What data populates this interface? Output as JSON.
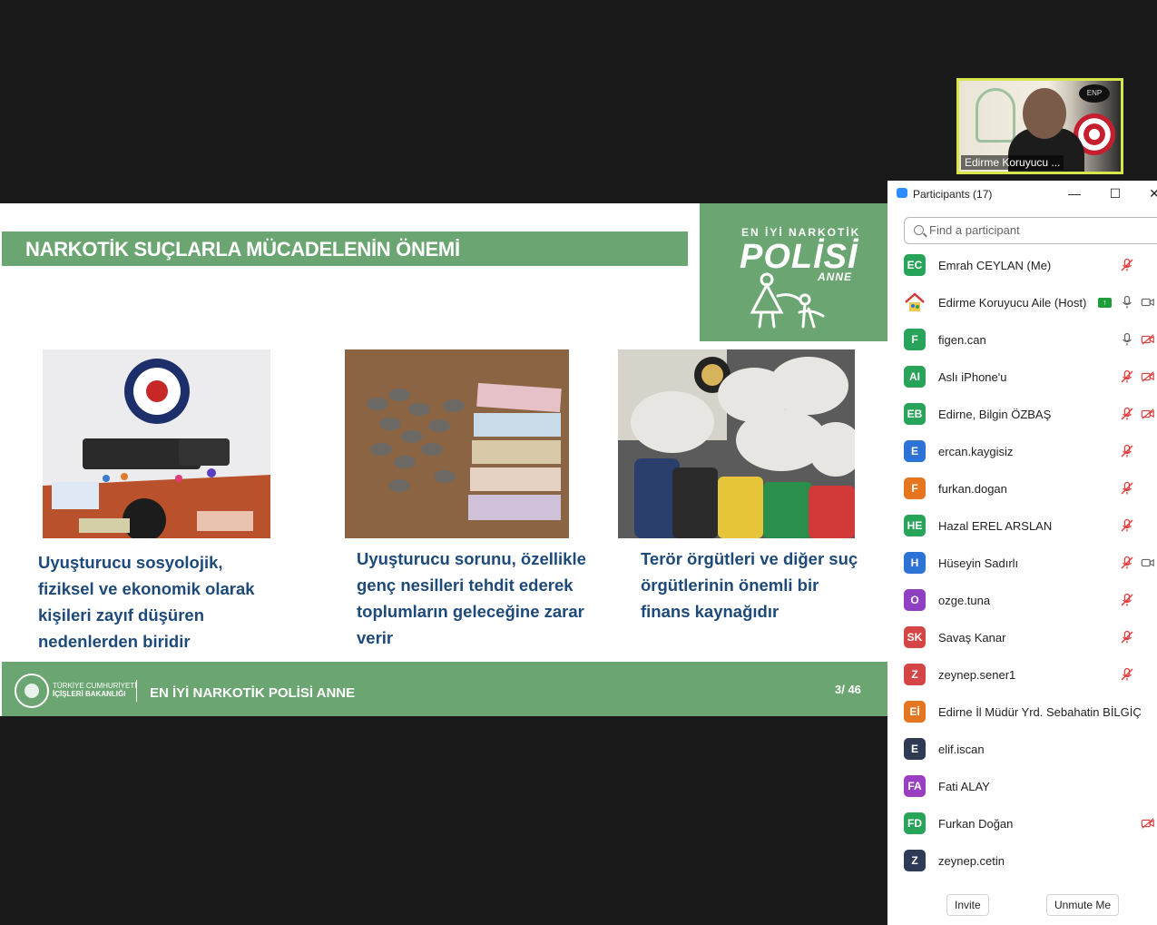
{
  "video": {
    "participant_label": "Edirme Koruyucu ..."
  },
  "slide": {
    "title": "NARKOTİK SUÇLARLA MÜCADELENİN ÖNEMİ",
    "brand": {
      "top": "EN İYİ NARKOTİK",
      "main": "POLİSİ",
      "sub": "ANNE"
    },
    "captions": [
      "Uyuşturucu sosyolojik, fiziksel ve ekonomik olarak kişileri zayıf düşüren nedenlerden biridir",
      "Uyuşturucu sorunu, özellikle genç nesilleri tehdit ederek toplumların geleceğine zarar verir",
      "Terör örgütleri ve diğer suç örgütlerinin önemli bir finans kaynağıdır"
    ],
    "footer": {
      "ministry_line1": "TÜRKİYE CUMHURİYETİ",
      "ministry_line2": "İÇİŞLERİ BAKANLIĞI",
      "title": "EN İYİ NARKOTİK POLİSİ ANNE",
      "page": "3/ 46"
    }
  },
  "panel": {
    "title": "Participants (17)",
    "search_placeholder": "Find a participant",
    "participants": [
      {
        "initials": "EC",
        "name": "Emrah CEYLAN (Me)",
        "color": "#27a35a",
        "mic": "muted-red",
        "video": "none"
      },
      {
        "initials": "",
        "name": "Edirme Koruyucu Aile (Host)",
        "color": "#ffffff",
        "mic": "on",
        "video": "on",
        "sharing": true
      },
      {
        "initials": "F",
        "name": "figen.can",
        "color": "#27a35a",
        "mic": "on",
        "video": "off"
      },
      {
        "initials": "AI",
        "name": "Aslı iPhone'u",
        "color": "#27a35a",
        "mic": "muted-red",
        "video": "off"
      },
      {
        "initials": "EB",
        "name": "Edirne, Bilgin ÖZBAŞ",
        "color": "#27a35a",
        "mic": "muted-red",
        "video": "off"
      },
      {
        "initials": "E",
        "name": "ercan.kaygisiz",
        "color": "#2d73d6",
        "mic": "muted-red",
        "video": "none"
      },
      {
        "initials": "F",
        "name": "furkan.dogan",
        "color": "#e5761f",
        "mic": "muted-red",
        "video": "none"
      },
      {
        "initials": "HE",
        "name": "Hazal EREL ARSLAN",
        "color": "#27a35a",
        "mic": "muted-red",
        "video": "none"
      },
      {
        "initials": "H",
        "name": "Hüseyin Sadırlı",
        "color": "#2d73d6",
        "mic": "muted-red",
        "video": "on"
      },
      {
        "initials": "O",
        "name": "ozge.tuna",
        "color": "#8e3fc2",
        "mic": "muted-red",
        "video": "none"
      },
      {
        "initials": "SK",
        "name": "Savaş Kanar",
        "color": "#d64545",
        "mic": "muted-red",
        "video": "none"
      },
      {
        "initials": "Z",
        "name": "zeynep.sener1",
        "color": "#d64545",
        "mic": "muted-red",
        "video": "none"
      },
      {
        "initials": "Eİ",
        "name": "Edirne İl Müdür Yrd. Sebahatin BİLGİÇ",
        "color": "#e5761f",
        "mic": "none",
        "video": "none"
      },
      {
        "initials": "E",
        "name": "elif.iscan",
        "color": "#2f3b55",
        "mic": "none",
        "video": "none"
      },
      {
        "initials": "FA",
        "name": "Fati ALAY",
        "color": "#9b3fc2",
        "mic": "none",
        "video": "none"
      },
      {
        "initials": "FD",
        "name": "Furkan Doğan",
        "color": "#27a35a",
        "mic": "none",
        "video": "off"
      },
      {
        "initials": "Z",
        "name": "zeynep.cetin",
        "color": "#2f3b55",
        "mic": "none",
        "video": "none"
      }
    ],
    "invite_label": "Invite",
    "unmute_label": "Unmute Me"
  },
  "colors": {
    "slide_green": "#6ba571",
    "caption_blue": "#1d4a7a",
    "active_speaker": "#d7e64a",
    "muted_red": "#e23b3b"
  }
}
